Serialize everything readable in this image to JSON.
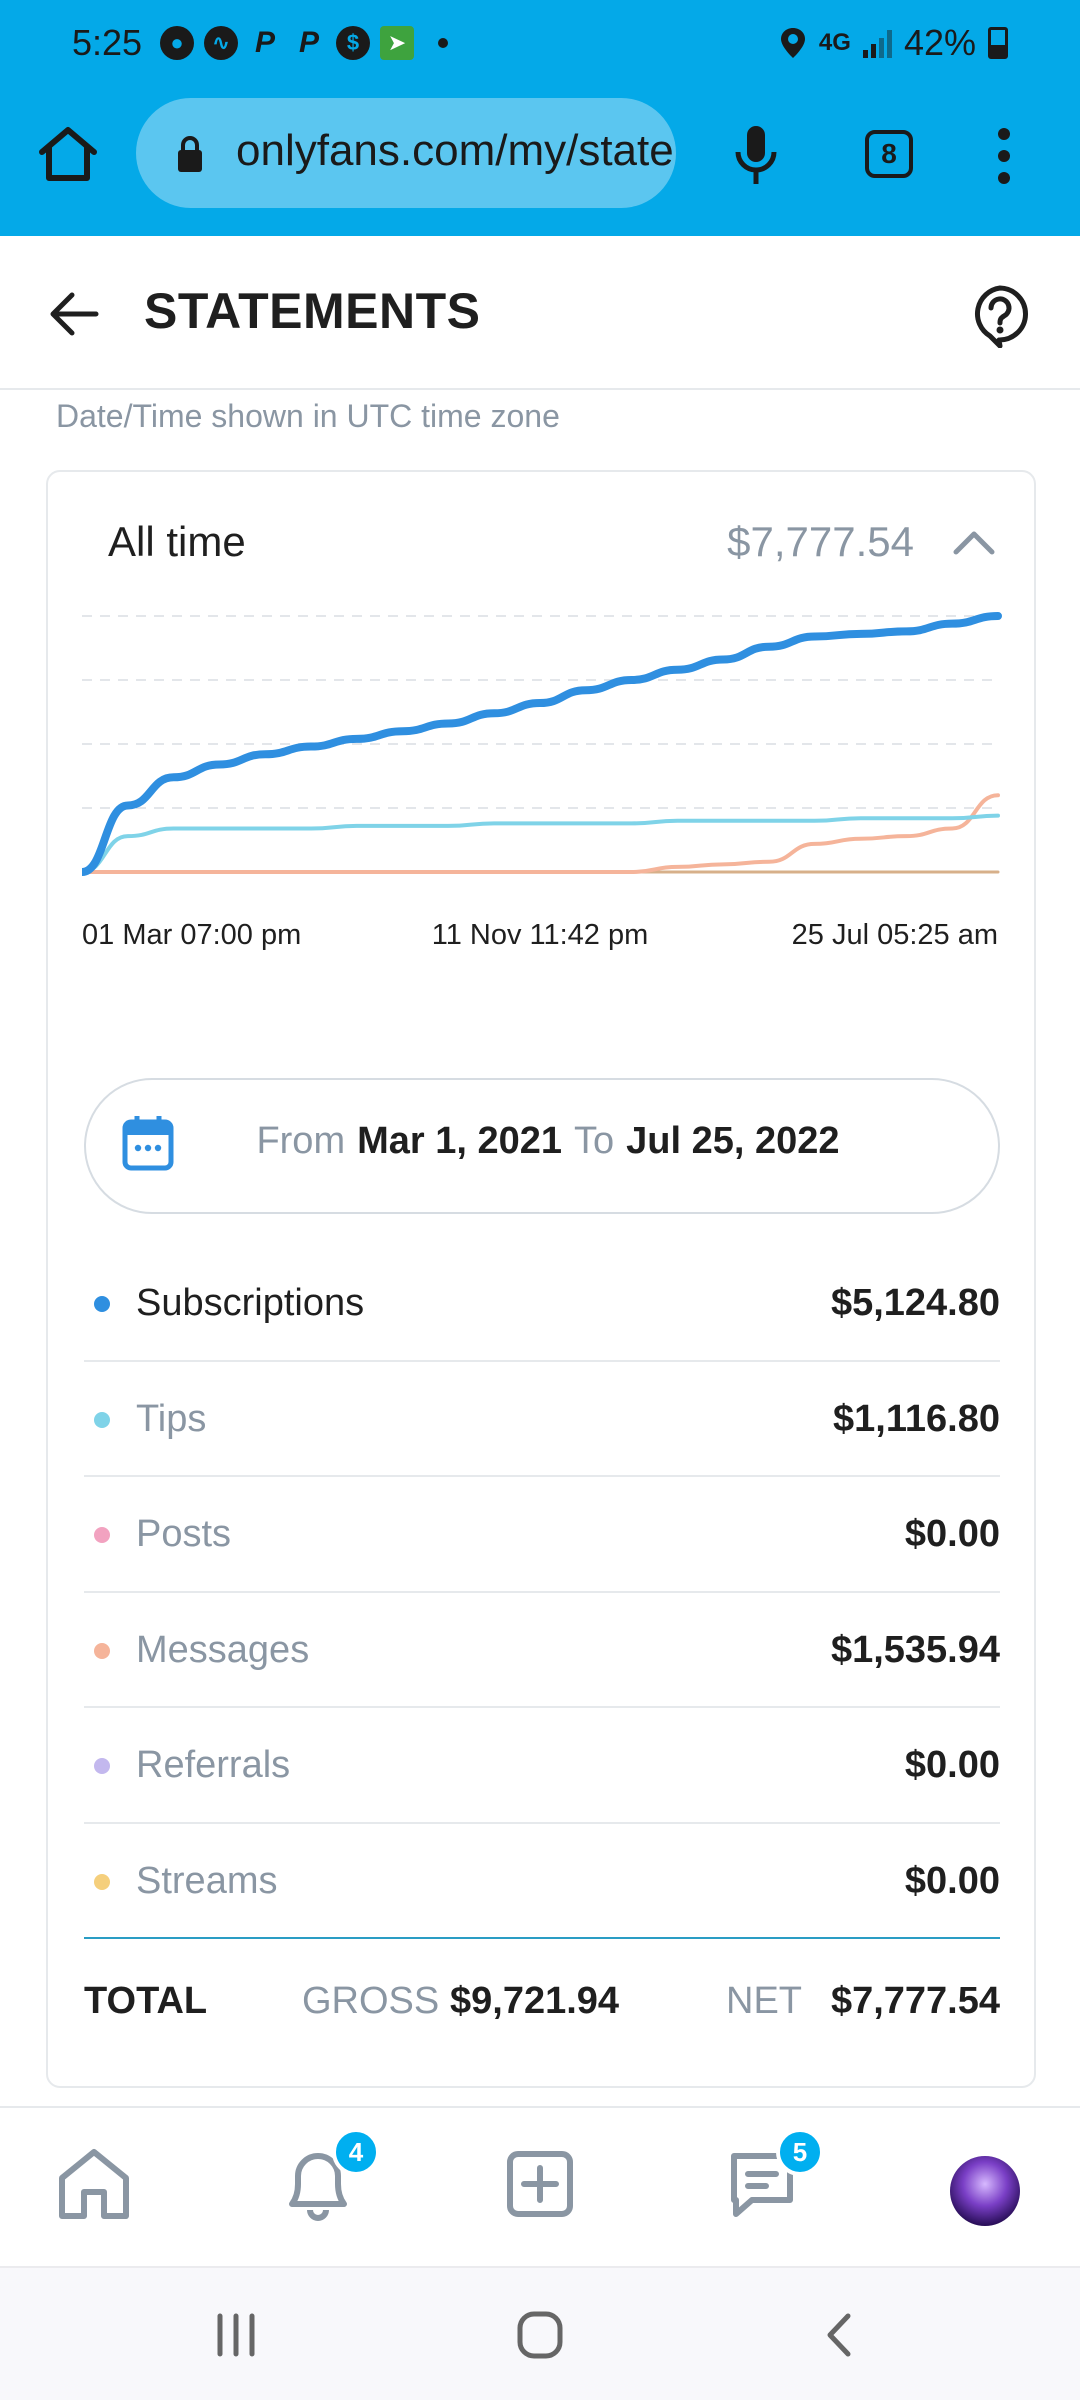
{
  "status_bar": {
    "time": "5:25",
    "network": "4G",
    "battery": "42%"
  },
  "browser": {
    "url": "onlyfans.com/my/statements",
    "tab_count": "8"
  },
  "header": {
    "title": "STATEMENTS"
  },
  "timezone_note": "Date/Time shown in UTC time zone",
  "card": {
    "period_label": "All time",
    "period_total": "$7,777.54"
  },
  "chart_data": {
    "type": "line",
    "title": "",
    "x_tick_labels": [
      "01 Mar 07:00 pm",
      "11 Nov 11:42 pm",
      "25 Jul 05:25 am"
    ],
    "x": [
      0,
      0.05,
      0.1,
      0.15,
      0.2,
      0.25,
      0.3,
      0.35,
      0.4,
      0.45,
      0.5,
      0.55,
      0.6,
      0.65,
      0.7,
      0.75,
      0.8,
      0.85,
      0.9,
      0.95,
      1.0
    ],
    "grid": true,
    "legend": "none",
    "series": [
      {
        "key": "subscriptions",
        "color": "#2f8fe0",
        "values": [
          0,
          0.26,
          0.37,
          0.42,
          0.46,
          0.49,
          0.52,
          0.55,
          0.58,
          0.62,
          0.66,
          0.71,
          0.75,
          0.79,
          0.83,
          0.88,
          0.92,
          0.93,
          0.94,
          0.97,
          1.0
        ]
      },
      {
        "key": "tips",
        "color": "#7fd3e8",
        "values": [
          0,
          0.14,
          0.17,
          0.17,
          0.17,
          0.17,
          0.18,
          0.18,
          0.18,
          0.19,
          0.19,
          0.19,
          0.19,
          0.2,
          0.2,
          0.2,
          0.2,
          0.21,
          0.21,
          0.21,
          0.22
        ]
      },
      {
        "key": "messages",
        "color": "#f5b49a",
        "values": [
          0,
          0,
          0,
          0,
          0,
          0,
          0,
          0,
          0,
          0,
          0,
          0,
          0,
          0.02,
          0.03,
          0.04,
          0.11,
          0.13,
          0.14,
          0.17,
          0.3
        ]
      },
      {
        "key": "posts",
        "color": "#d7b08a",
        "values": [
          0,
          0,
          0,
          0,
          0,
          0,
          0,
          0,
          0,
          0,
          0,
          0,
          0,
          0,
          0,
          0,
          0,
          0,
          0,
          0,
          0
        ]
      }
    ]
  },
  "date_range": {
    "from_label": "From",
    "from_value": "Mar 1, 2021",
    "to_label": "To",
    "to_value": "Jul 25, 2022"
  },
  "categories": [
    {
      "name": "Subscriptions",
      "amount": "$5,124.80",
      "color": "#2f8fe0",
      "active": true
    },
    {
      "name": "Tips",
      "amount": "$1,116.80",
      "color": "#7fd3e8",
      "active": false
    },
    {
      "name": "Posts",
      "amount": "$0.00",
      "color": "#f2a2c0",
      "active": false
    },
    {
      "name": "Messages",
      "amount": "$1,535.94",
      "color": "#f5b49a",
      "active": false
    },
    {
      "name": "Referrals",
      "amount": "$0.00",
      "color": "#c3b8ee",
      "active": false
    },
    {
      "name": "Streams",
      "amount": "$0.00",
      "color": "#f5cf7c",
      "active": false
    }
  ],
  "totals": {
    "label": "TOTAL",
    "gross_label": "GROSS",
    "gross_value": "$9,721.94",
    "net_label": "NET",
    "net_value": "$7,777.54"
  },
  "bottom_nav": {
    "notifications_badge": "4",
    "messages_badge": "5"
  },
  "colors": {
    "chrome": "#04a9e8",
    "accent": "#00aff0"
  }
}
